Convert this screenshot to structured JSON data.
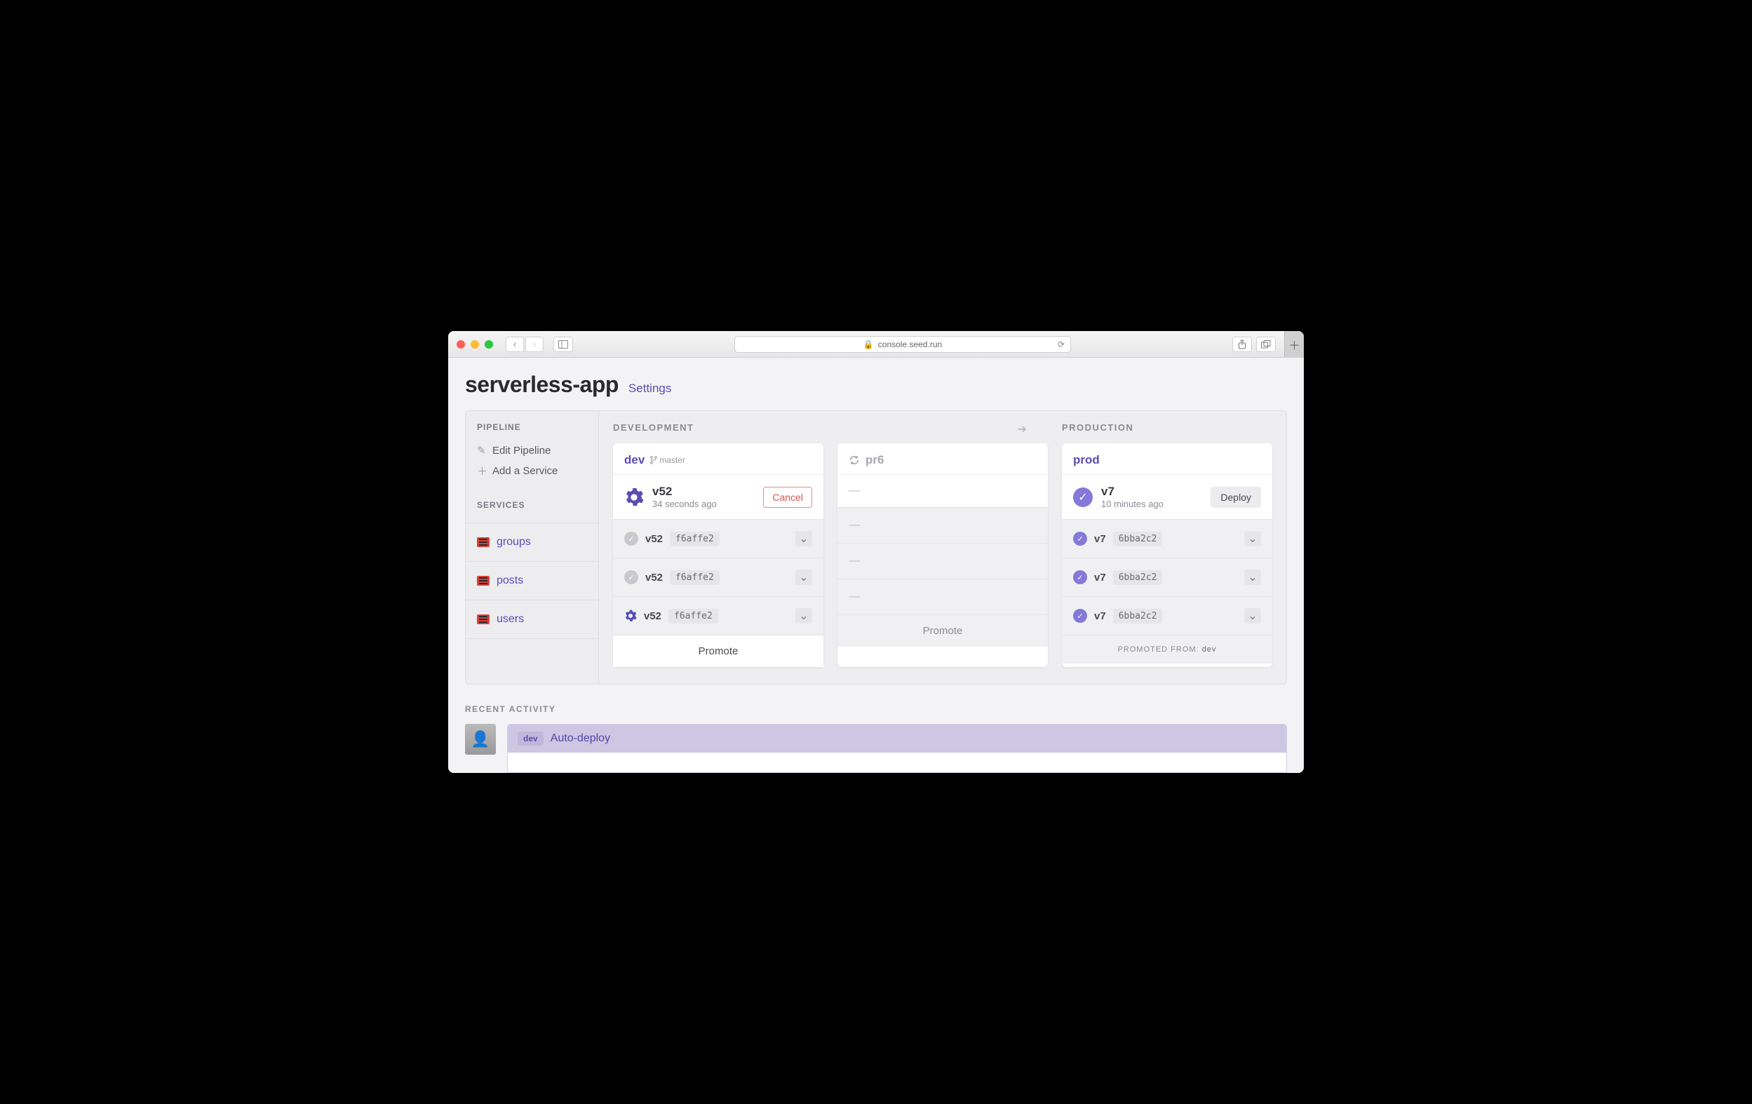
{
  "browser": {
    "url": "console.seed.run"
  },
  "header": {
    "title": "serverless-app",
    "settings": "Settings"
  },
  "sidebar": {
    "pipeline_heading": "PIPELINE",
    "edit_pipeline": "Edit Pipeline",
    "add_service": "Add a Service",
    "services_heading": "SERVICES",
    "services": [
      {
        "name": "groups"
      },
      {
        "name": "posts"
      },
      {
        "name": "users"
      }
    ]
  },
  "stages": {
    "dev_heading": "DEVELOPMENT",
    "prod_heading": "PRODUCTION",
    "columns": [
      {
        "name": "dev",
        "branch": "master",
        "build": {
          "version": "v52",
          "time": "34 seconds ago",
          "action": "Cancel",
          "status": "building"
        },
        "services": [
          {
            "status": "done",
            "version": "v52",
            "hash": "f6affe2"
          },
          {
            "status": "done",
            "version": "v52",
            "hash": "f6affe2"
          },
          {
            "status": "building",
            "version": "v52",
            "hash": "f6affe2"
          }
        ],
        "footer_label": "Promote"
      },
      {
        "name": "pr6",
        "services": [
          {},
          {},
          {}
        ],
        "footer_label": "Promote"
      },
      {
        "name": "prod",
        "build": {
          "version": "v7",
          "time": "10 minutes ago",
          "action": "Deploy",
          "status": "success"
        },
        "services": [
          {
            "status": "success",
            "version": "v7",
            "hash": "6bba2c2"
          },
          {
            "status": "success",
            "version": "v7",
            "hash": "6bba2c2"
          },
          {
            "status": "success",
            "version": "v7",
            "hash": "6bba2c2"
          }
        ],
        "footer_prefix": "PROMOTED FROM:",
        "footer_value": "dev"
      }
    ]
  },
  "activity": {
    "heading": "RECENT ACTIVITY",
    "items": [
      {
        "badge": "dev",
        "title": "Auto-deploy"
      }
    ]
  }
}
